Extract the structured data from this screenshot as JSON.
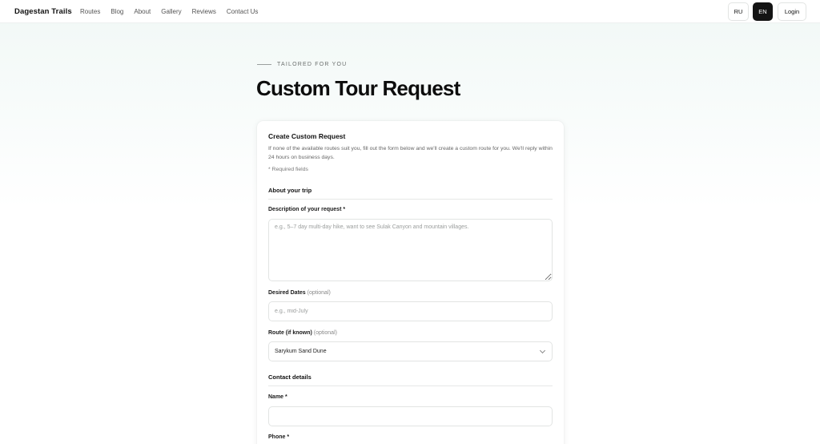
{
  "header": {
    "brand": "Dagestan Trails",
    "nav": [
      "Routes",
      "Blog",
      "About",
      "Gallery",
      "Reviews",
      "Contact Us"
    ],
    "lang_ru": "RU",
    "lang_en": "EN",
    "login": "Login"
  },
  "hero": {
    "eyebrow": "TAILORED FOR YOU",
    "title": "Custom Tour Request"
  },
  "form": {
    "title": "Create Custom Request",
    "description": "If none of the available routes suit you, fill out the form below and we'll create a custom route for you. We'll reply within 24 hours on business days.",
    "required_note": "* Required fields",
    "section_trip": "About your trip",
    "desc_label": "Description of your request *",
    "desc_placeholder": "e.g., 5–7 day multi-day hike, want to see Sulak Canyon and mountain villages.",
    "dates_label": "Desired Dates",
    "dates_optional": "(optional)",
    "dates_placeholder": "e.g., mid-July",
    "route_label": "Route (if known)",
    "route_optional": "(optional)",
    "route_value": "Sarykum Sand Dune",
    "section_contact": "Contact details",
    "name_label": "Name *",
    "name_value": "",
    "phone_label": "Phone *"
  }
}
